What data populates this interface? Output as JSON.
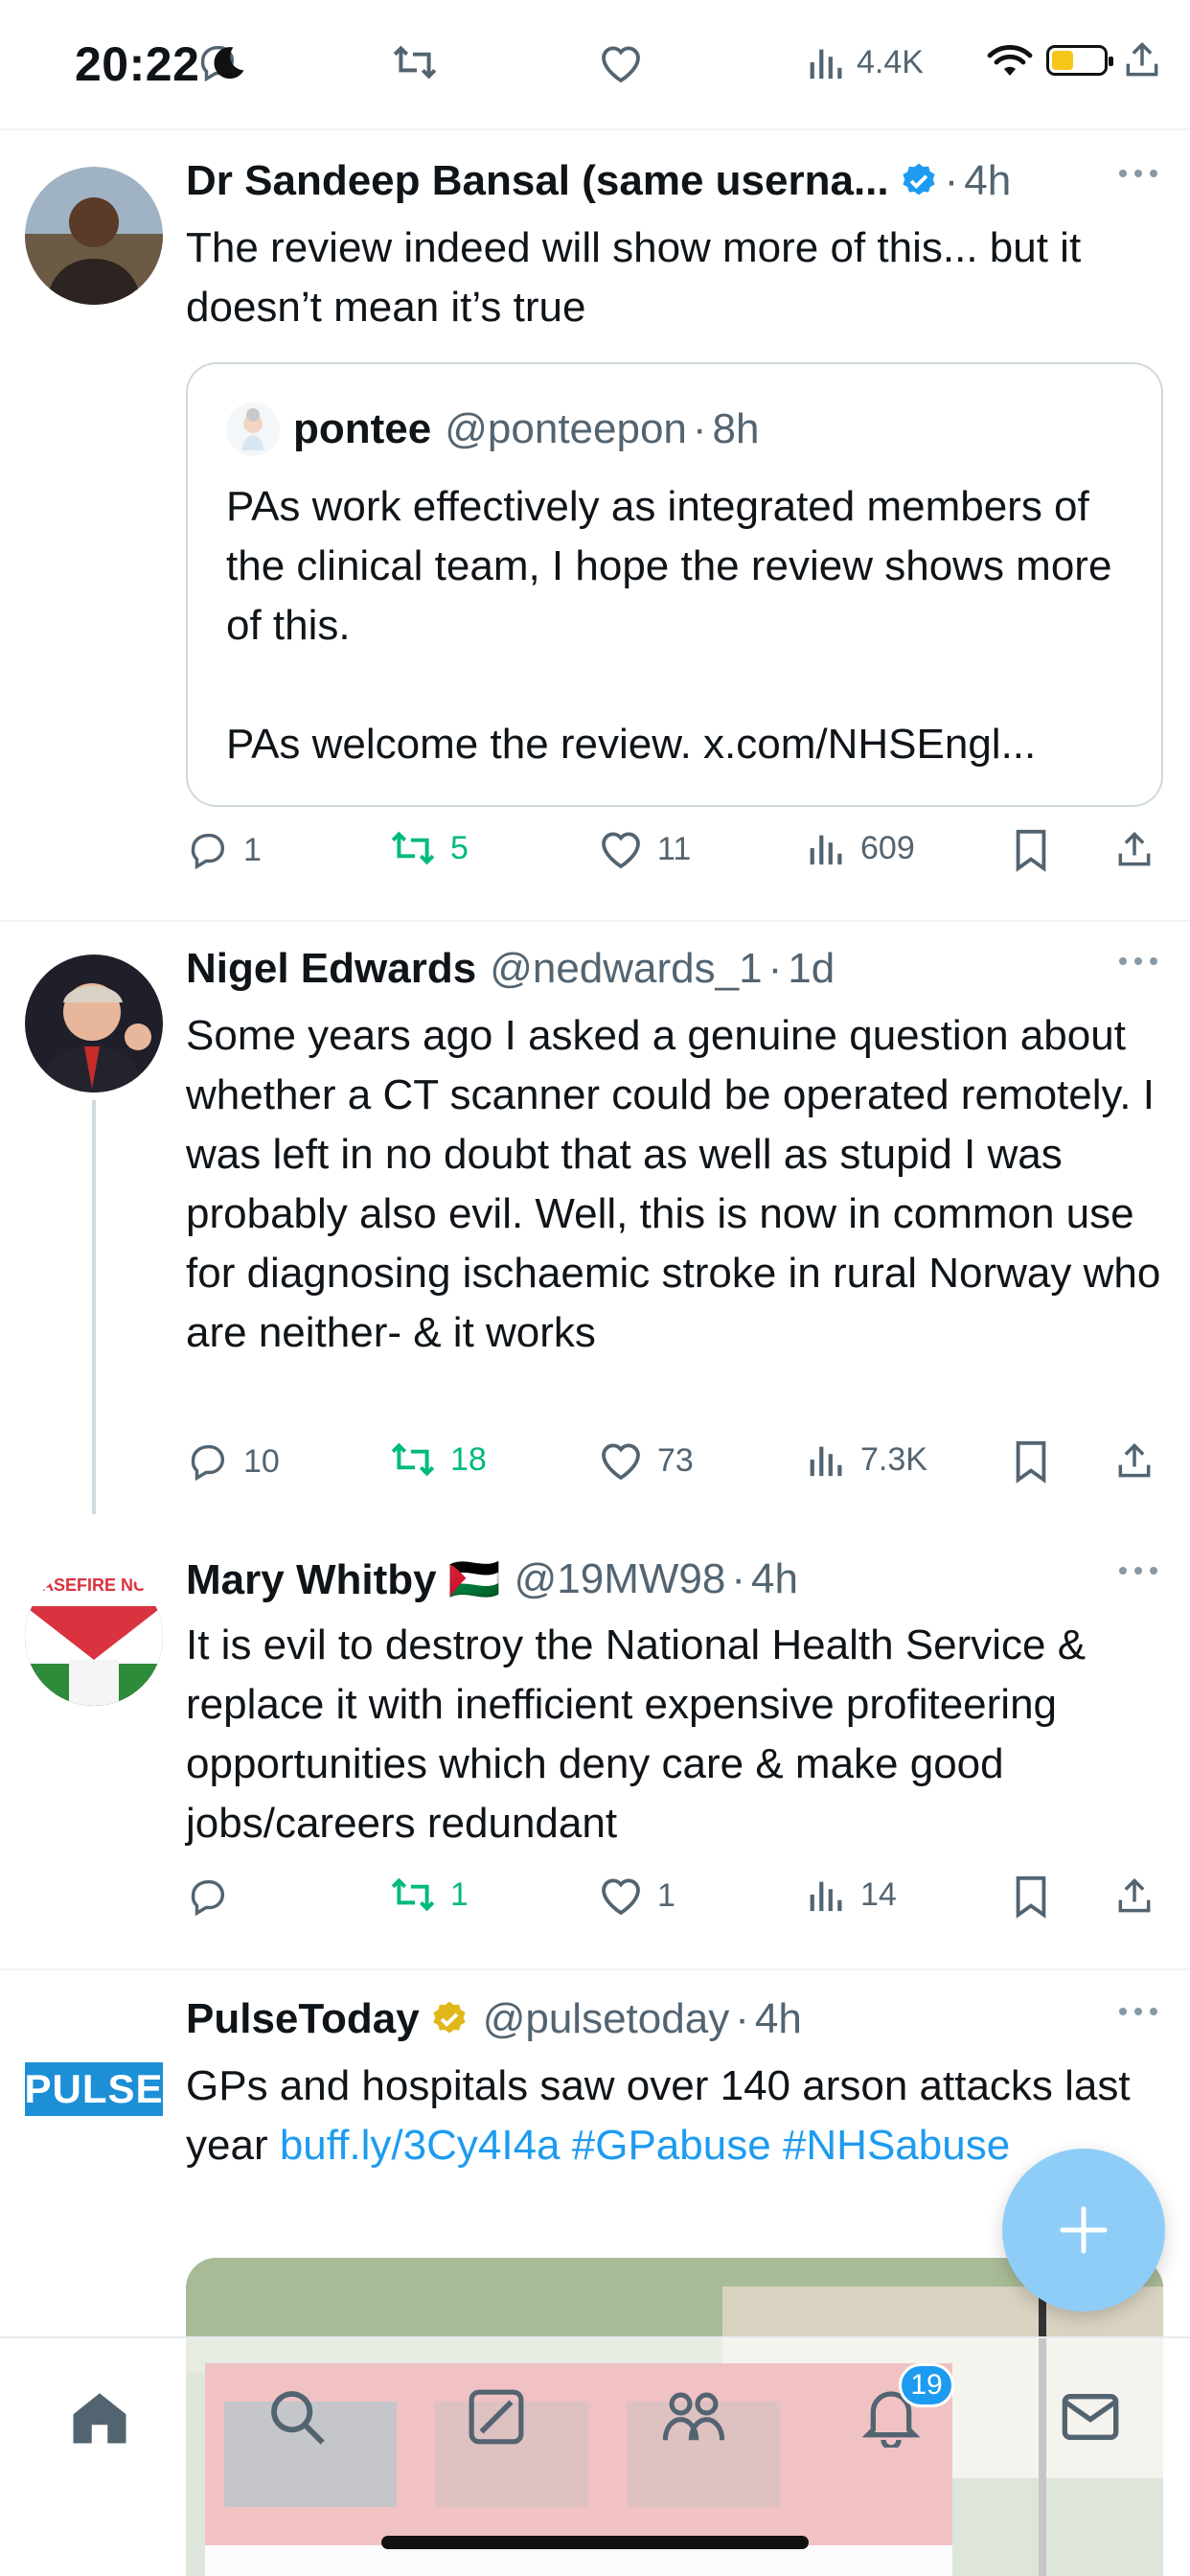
{
  "status_bar": {
    "time": "20:22",
    "top_views": "4.4K"
  },
  "tweets": [
    {
      "name": "Dr Sandeep Bansal (same userna...",
      "verified": "blue",
      "time": "4h",
      "text": "The review indeed will show more of this... but it doesn’t mean it’s true",
      "quote": {
        "name": "pontee",
        "handle": "@ponteepon",
        "time": "8h",
        "text_1": "PAs work effectively as integrated members of the clinical team, I hope the review shows more of this.",
        "text_2": "PAs welcome the review. x.com/NHSEngl..."
      },
      "replies": "1",
      "retweets": "5",
      "likes": "11",
      "views": "609"
    },
    {
      "name": "Nigel Edwards",
      "handle": "@nedwards_1",
      "time": "1d",
      "text": "Some years ago I asked a genuine question about whether a CT scanner could be operated remotely.  I was left in no doubt that as well as stupid I was probably also evil.  Well, this is now in common use  for diagnosing ischaemic stroke in rural Norway who are neither- & it works",
      "replies": "10",
      "retweets": "18",
      "likes": "73",
      "views": "7.3K"
    },
    {
      "name": "Mary Whitby 🇵🇸",
      "handle": "@19MW98",
      "time": "4h",
      "text": "It is evil to destroy the National Health Service & replace it with inefficient expensive profiteering opportunities which deny care & make good jobs/careers redundant",
      "replies": "",
      "retweets": "1",
      "likes": "1",
      "views": "14",
      "avatar_text": "ASEFIRE NO"
    },
    {
      "name": "PulseToday",
      "verified": "gold",
      "handle": "@pulsetoday",
      "time": "4h",
      "text": "GPs and hospitals saw over 140 arson attacks last year ",
      "link_1": "buff.ly/3Cy4I4a",
      "link_2": "#GPabuse",
      "link_3": "#NHSabuse",
      "avatar_text": "PULSE"
    }
  ],
  "tab_bar": {
    "notifications_badge": "19"
  }
}
